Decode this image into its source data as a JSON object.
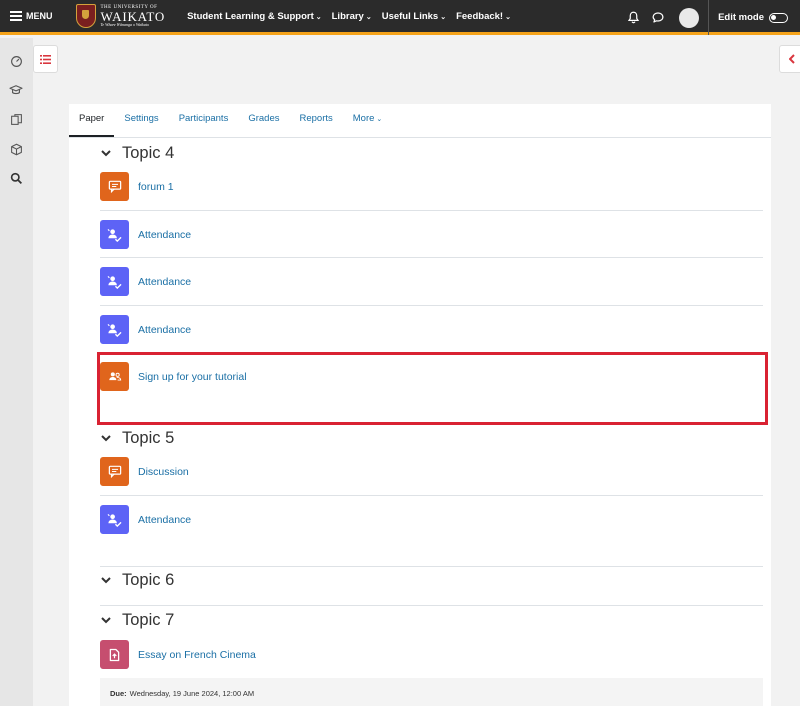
{
  "topbar": {
    "menu_label": "MENU",
    "logo": {
      "line1": "THE UNIVERSITY OF",
      "line2": "WAIKATO",
      "line3": "Te Whare Wānanga o Waikato"
    },
    "nav": [
      {
        "label": "Student Learning & Support"
      },
      {
        "label": "Library"
      },
      {
        "label": "Useful Links"
      },
      {
        "label": "Feedback!"
      }
    ],
    "edit_mode_label": "Edit mode",
    "edit_mode_on": false,
    "accent_color": "#f5a31a"
  },
  "tabs": [
    {
      "label": "Paper",
      "active": true
    },
    {
      "label": "Settings"
    },
    {
      "label": "Participants"
    },
    {
      "label": "Grades"
    },
    {
      "label": "Reports"
    },
    {
      "label": "More"
    }
  ],
  "sections": [
    {
      "title": "Topic 4",
      "activities": [
        {
          "label": "forum 1",
          "icon": "forum-icon",
          "color": "#e0651c"
        },
        {
          "label": "Attendance",
          "icon": "attendance-icon",
          "color": "#5d63f6"
        },
        {
          "label": "Attendance",
          "icon": "attendance-icon",
          "color": "#5d63f6"
        },
        {
          "label": "Attendance",
          "icon": "attendance-icon",
          "color": "#5d63f6"
        },
        {
          "label": "Sign up for your tutorial",
          "icon": "group-signup-icon",
          "color": "#e0651c"
        }
      ]
    },
    {
      "title": "Topic 5",
      "activities": [
        {
          "label": "Discussion",
          "icon": "forum-icon",
          "color": "#e0651c"
        },
        {
          "label": "Attendance",
          "icon": "attendance-icon",
          "color": "#5d63f6"
        }
      ]
    },
    {
      "title": "Topic 6",
      "activities": []
    },
    {
      "title": "Topic 7",
      "activities": [
        {
          "label": "Essay on French Cinema",
          "icon": "assignment-icon",
          "color": "#c64e6f"
        }
      ],
      "due": {
        "label": "Due:",
        "value": "Wednesday, 19 June 2024, 12:00 AM"
      }
    }
  ],
  "highlight_color": "#d92232"
}
